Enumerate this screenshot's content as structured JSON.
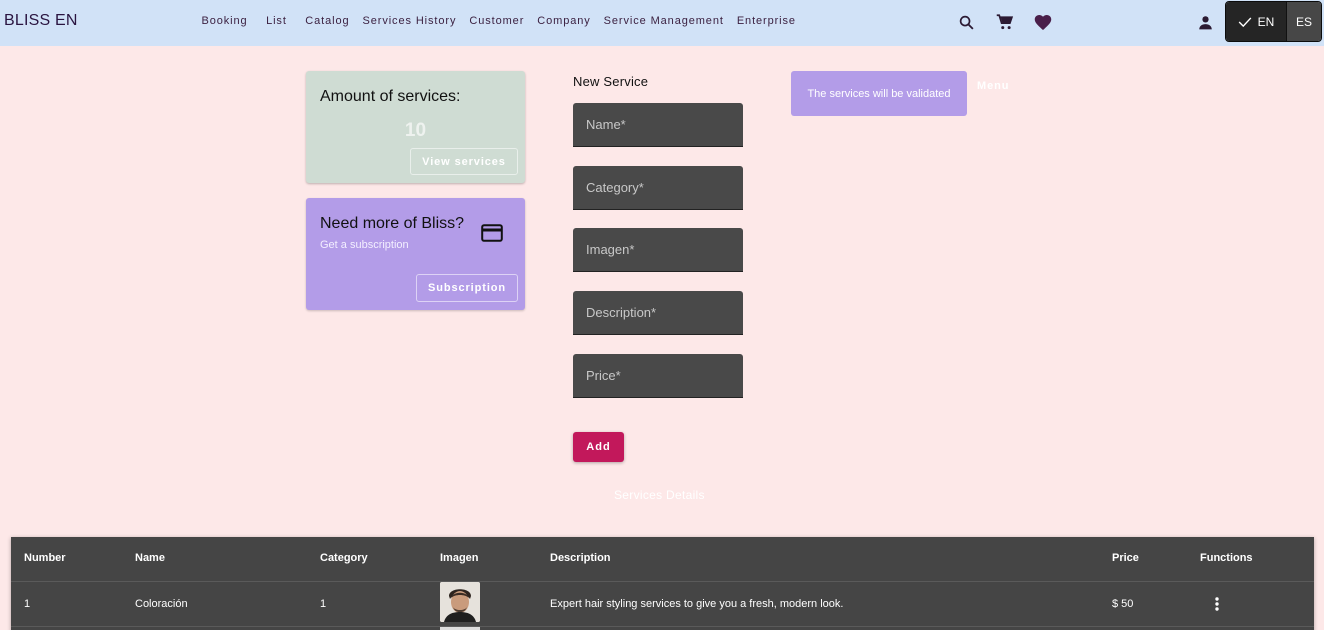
{
  "app": {
    "brand": "BLISS EN"
  },
  "nav": {
    "items": [
      {
        "label": "Booking",
        "name": "nav-booking"
      },
      {
        "label": "List",
        "name": "nav-list"
      },
      {
        "label": "Catalog",
        "name": "nav-catalog"
      },
      {
        "label": "Services History",
        "name": "nav-services-history"
      },
      {
        "label": "Customer",
        "name": "nav-customer"
      },
      {
        "label": "Company",
        "name": "nav-company"
      },
      {
        "label": "Service Management",
        "name": "nav-service-management"
      },
      {
        "label": "Enterprise",
        "name": "nav-enterprise"
      }
    ],
    "icons": [
      "search-icon",
      "cart-icon",
      "heart-icon",
      "person-icon"
    ]
  },
  "language": {
    "selected": "EN",
    "options": [
      "EN",
      "ES"
    ]
  },
  "amount_card": {
    "title": "Amount of services:",
    "count": "10",
    "button": "View services"
  },
  "subscription_card": {
    "title": "Need more of Bliss?",
    "subtitle": "Get a subscription",
    "button": "Subscription",
    "icon": "credit-card-icon"
  },
  "form": {
    "title": "New Service",
    "fields": [
      {
        "placeholder": "Name*"
      },
      {
        "placeholder": "Category*"
      },
      {
        "placeholder": "Imagen*"
      },
      {
        "placeholder": "Description*"
      },
      {
        "placeholder": "Price*"
      }
    ],
    "submit": "Add"
  },
  "notice": {
    "text": "The services will be validated",
    "menu": "Menu"
  },
  "details": {
    "title": "Services Details"
  },
  "table": {
    "columns": [
      "Number",
      "Name",
      "Category",
      "Imagen",
      "Description",
      "Price",
      "Functions"
    ],
    "rows": [
      {
        "number": "1",
        "name": "Coloración",
        "category": "1",
        "description": "Expert hair styling services to give you a fresh, modern look.",
        "price": "$ 50"
      }
    ]
  },
  "colors": {
    "topbar": "#d1e2f7",
    "background": "#fde8e8",
    "accent": "#c2185b",
    "lavender": "#b39ce8",
    "sage": "#cfdcd3",
    "table": "#454545"
  }
}
